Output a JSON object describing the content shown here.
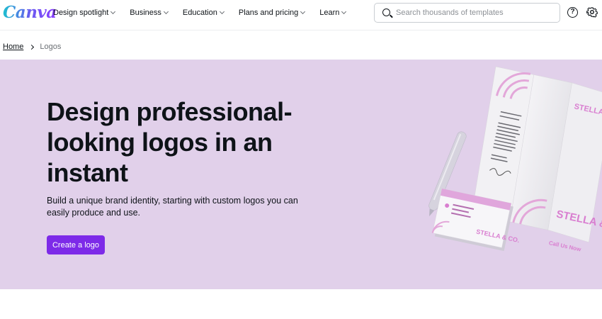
{
  "brand": {
    "logo_text": "Canva",
    "accent": "#7d2ae8",
    "hero_bg": "#e1d0ea"
  },
  "nav": {
    "items": [
      {
        "label": "Design spotlight"
      },
      {
        "label": "Business"
      },
      {
        "label": "Education"
      },
      {
        "label": "Plans and pricing"
      },
      {
        "label": "Learn"
      }
    ]
  },
  "search": {
    "placeholder": "Search thousands of templates",
    "value": ""
  },
  "header_icons": {
    "help": "help-icon",
    "settings": "gear-icon"
  },
  "breadcrumb": {
    "home": "Home",
    "current": "Logos"
  },
  "hero": {
    "title": "Design professional-looking logos in an instant",
    "subtitle": "Build a unique brand identity, starting with custom logos you can easily produce and use.",
    "cta_label": "Create a logo",
    "mockup": {
      "brand_name_top": "STELLA & CO.",
      "brand_name_bottom": "STELLA & CO.",
      "card_name": "STELLA & CO.",
      "call_text": "Call Us Now"
    }
  }
}
